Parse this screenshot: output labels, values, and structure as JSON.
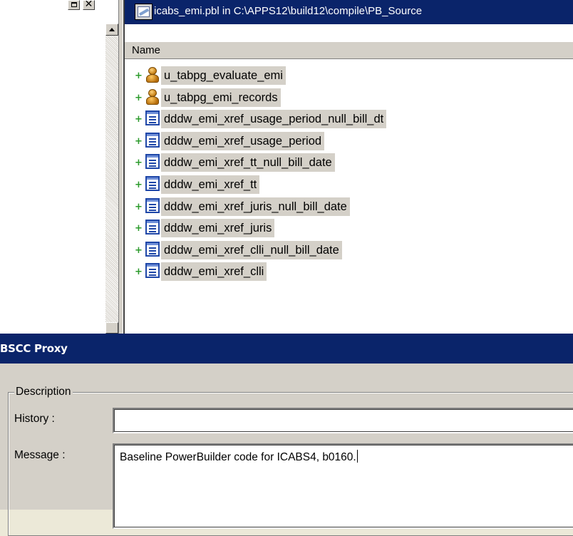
{
  "library_window": {
    "title": "icabs_emi.pbl in C:\\APPS12\\build12\\compile\\PB_Source",
    "column_header": "Name",
    "objects": [
      {
        "name": "u_tabpg_evaluate_emi",
        "icon": "user-object-icon"
      },
      {
        "name": "u_tabpg_emi_records",
        "icon": "user-object-icon"
      },
      {
        "name": "dddw_emi_xref_usage_period_null_bill_dt",
        "icon": "datawindow-icon"
      },
      {
        "name": "dddw_emi_xref_usage_period",
        "icon": "datawindow-icon"
      },
      {
        "name": "dddw_emi_xref_tt_null_bill_date",
        "icon": "datawindow-icon"
      },
      {
        "name": "dddw_emi_xref_tt",
        "icon": "datawindow-icon"
      },
      {
        "name": "dddw_emi_xref_juris_null_bill_date",
        "icon": "datawindow-icon"
      },
      {
        "name": "dddw_emi_xref_juris",
        "icon": "datawindow-icon"
      },
      {
        "name": "dddw_emi_xref_clli_null_bill_date",
        "icon": "datawindow-icon"
      },
      {
        "name": "dddw_emi_xref_clli",
        "icon": "datawindow-icon"
      }
    ],
    "expand_glyph": "+"
  },
  "left_pane": {
    "close_glyph": "✕"
  },
  "proxy_dialog": {
    "title": "BSCC Proxy",
    "group_label": "Description",
    "history_label": "History :",
    "history_value": "",
    "message_label": "Message :",
    "message_value": "Baseline PowerBuilder code for ICABS4, b0160."
  },
  "colors": {
    "titlebar": "#0a246a",
    "chrome": "#d4d0c8",
    "selection": "#d4d0c8",
    "expand": "#2a9a2a"
  }
}
